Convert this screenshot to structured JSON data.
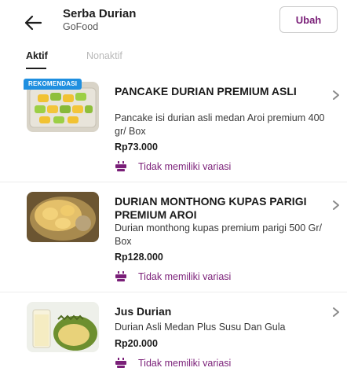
{
  "header": {
    "back_icon": "arrow-left-icon",
    "title": "Serba Durian",
    "subtitle": "GoFood",
    "edit_label": "Ubah"
  },
  "tabs": [
    {
      "label": "Aktif",
      "active": true
    },
    {
      "label": "Nonaktif",
      "active": false
    }
  ],
  "colors": {
    "accent": "#7a1f78",
    "badge": "#1f8fe0"
  },
  "items": [
    {
      "badge": "REKOMENDASI",
      "name": "PANCAKE DURIAN PREMIUM ASLI",
      "description": "Pancake isi durian asli medan Aroi premium 400 gr/ Box",
      "price": "Rp73.000",
      "variant": "Tidak memiliki variasi"
    },
    {
      "name": "DURIAN MONTHONG KUPAS PARIGI PREMIUM AROI",
      "description": "Durian monthong kupas premium parigi 500 Gr/ Box",
      "price": "Rp128.000",
      "variant": "Tidak memiliki variasi"
    },
    {
      "name": "Jus Durian",
      "description": "Durian Asli Medan Plus Susu Dan Gula",
      "price": "Rp20.000",
      "variant": "Tidak memiliki variasi"
    }
  ]
}
